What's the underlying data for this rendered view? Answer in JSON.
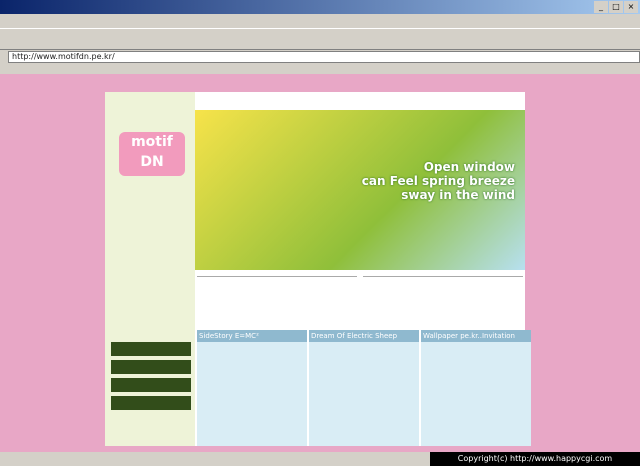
{
  "window": {
    "title": ""
  },
  "menu": [],
  "toolbar": [],
  "address": {
    "label": "",
    "url": "http://www.motifdn.pe.kr/"
  },
  "links": [],
  "site": {
    "logo": "motif DN",
    "intro": "",
    "banners": [
      "",
      "",
      "",
      ""
    ],
    "hero_slogan": [
      "Open window",
      "can Feel spring breeze",
      "sway in the wind"
    ],
    "news_left": {
      "title": "",
      "items": []
    },
    "news_right": {
      "title": "",
      "items": []
    },
    "features": [
      {
        "head": "SideStory E=MC²",
        "body": ""
      },
      {
        "head": "Dream Of Electric Sheep",
        "body": ""
      },
      {
        "head": "Wallpaper pe.kr..Invitation",
        "body": ""
      }
    ]
  },
  "copyright": "Copyright(c) http://www.happycgi.com"
}
